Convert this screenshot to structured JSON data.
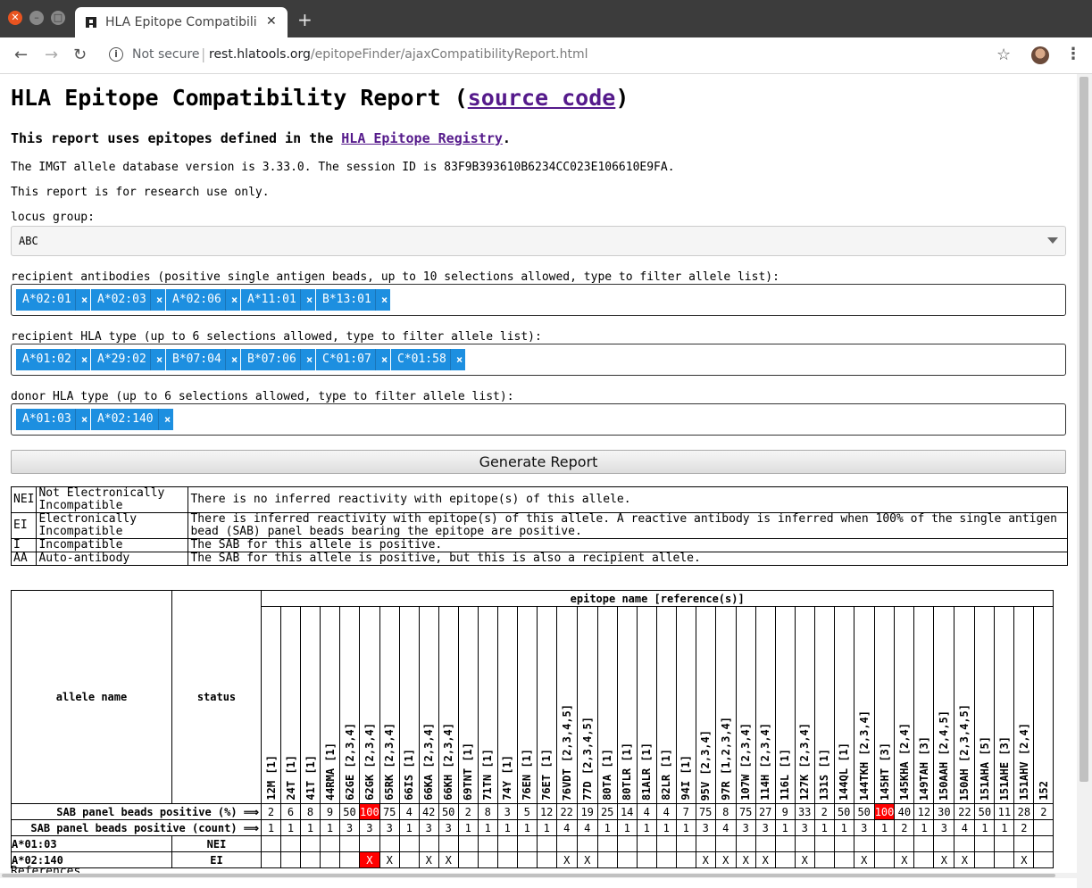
{
  "browser": {
    "tab_title": "HLA Epitope Compatibilit",
    "not_secure": "Not secure",
    "url_host": "rest.hlatools.org",
    "url_path": "/epitopeFinder/ajaxCompatibilityReport.html"
  },
  "page": {
    "title": "HLA Epitope Compatibility Report (",
    "title_link": "source code",
    "title_end": ")",
    "subtitle_pre": "This report uses epitopes defined in the ",
    "subtitle_link": "HLA Epitope Registry",
    "subtitle_post": ".",
    "db_line": "The IMGT allele database version is 3.33.0. The session ID is 83F9B393610B6234CC023E106610E9FA.",
    "research_line": "This report is for research use only.",
    "locus_label": "locus group:",
    "locus_value": "ABC",
    "antibodies_label": "recipient antibodies (positive single antigen beads, up to 10 selections allowed, type to filter allele list):",
    "antibodies": [
      "A*02:01",
      "A*02:03",
      "A*02:06",
      "A*11:01",
      "B*13:01"
    ],
    "recipient_label": "recipient HLA type (up to 6 selections allowed, type to filter allele list):",
    "recipient": [
      "A*01:02",
      "A*29:02",
      "B*07:04",
      "B*07:06",
      "C*01:07",
      "C*01:58"
    ],
    "donor_label": "donor HLA type (up to 6 selections allowed, type to filter allele list):",
    "donor": [
      "A*01:03",
      "A*02:140"
    ],
    "chip_remove": "×",
    "generate_button": "Generate Report",
    "references_label": "References"
  },
  "legend": [
    {
      "code": "NEI",
      "name": "Not Electronically Incompatible",
      "desc": "There is no inferred reactivity with epitope(s) of this allele."
    },
    {
      "code": "EI",
      "name": "Electronically Incompatible",
      "desc": "There is inferred reactivity with epitope(s) of this allele. A reactive antibody is inferred when 100% of the single antigen bead (SAB) panel beads bearing the epitope are positive."
    },
    {
      "code": "I",
      "name": "Incompatible",
      "desc": "The SAB for this allele is positive."
    },
    {
      "code": "AA",
      "name": "Auto-antibody",
      "desc": "The SAB for this allele is positive, but this is also a recipient allele."
    }
  ],
  "report": {
    "col_allele": "allele name",
    "col_status": "status",
    "epitope_header": "epitope name [reference(s)]",
    "pct_label": "SAB panel beads positive (%) ⟹",
    "count_label": "SAB panel beads positive (count) ⟹",
    "epitopes": [
      "12M [1]",
      "24T [1]",
      "41T [1]",
      "44RMA [1]",
      "62GE [2,3,4]",
      "62GK [2,3,4]",
      "65RK [2,3,4]",
      "66IS [1]",
      "66KA [2,3,4]",
      "66KH [2,3,4]",
      "69TNT [1]",
      "71TN [1]",
      "74Y [1]",
      "76EN [1]",
      "76ET [1]",
      "76VDT [2,3,4,5]",
      "77D [2,3,4,5]",
      "80TA [1]",
      "80TLR [1]",
      "81ALR [1]",
      "82LR [1]",
      "94I [1]",
      "95V [2,3,4]",
      "97R [1,2,3,4]",
      "107W [2,3,4]",
      "114H [2,3,4]",
      "116L [1]",
      "127K [2,3,4]",
      "131S [1]",
      "144QL [1]",
      "144TKH [2,3,4]",
      "145HT [3]",
      "145KHA [2,4]",
      "149TAH [3]",
      "150AAH [2,4,5]",
      "150AH [2,3,4,5]",
      "151AHA [5]",
      "151AHE [3]",
      "151AHV [2,4]",
      "152"
    ],
    "percents": [
      "2",
      "6",
      "8",
      "9",
      "50",
      "100",
      "75",
      "4",
      "42",
      "50",
      "2",
      "8",
      "3",
      "5",
      "12",
      "22",
      "19",
      "25",
      "14",
      "4",
      "4",
      "7",
      "75",
      "8",
      "75",
      "27",
      "9",
      "33",
      "2",
      "50",
      "50",
      "100",
      "40",
      "12",
      "30",
      "22",
      "50",
      "11",
      "28",
      "2"
    ],
    "counts": [
      "1",
      "1",
      "1",
      "1",
      "3",
      "3",
      "3",
      "1",
      "3",
      "3",
      "1",
      "1",
      "1",
      "1",
      "1",
      "4",
      "4",
      "1",
      "1",
      "1",
      "1",
      "1",
      "3",
      "4",
      "3",
      "3",
      "1",
      "3",
      "1",
      "1",
      "3",
      "1",
      "2",
      "1",
      "3",
      "4",
      "1",
      "1",
      "2",
      ""
    ],
    "red_percent_indices": [
      5,
      31
    ],
    "rows": [
      {
        "allele": "A*01:03",
        "status": "NEI",
        "marks": []
      },
      {
        "allele": "A*02:140",
        "status": "EI",
        "marks": [
          5,
          6,
          8,
          9,
          15,
          16,
          22,
          23,
          24,
          25,
          27,
          30,
          32,
          34,
          35,
          38
        ],
        "red_marks": [
          5
        ]
      }
    ],
    "mark_symbol": "X"
  }
}
